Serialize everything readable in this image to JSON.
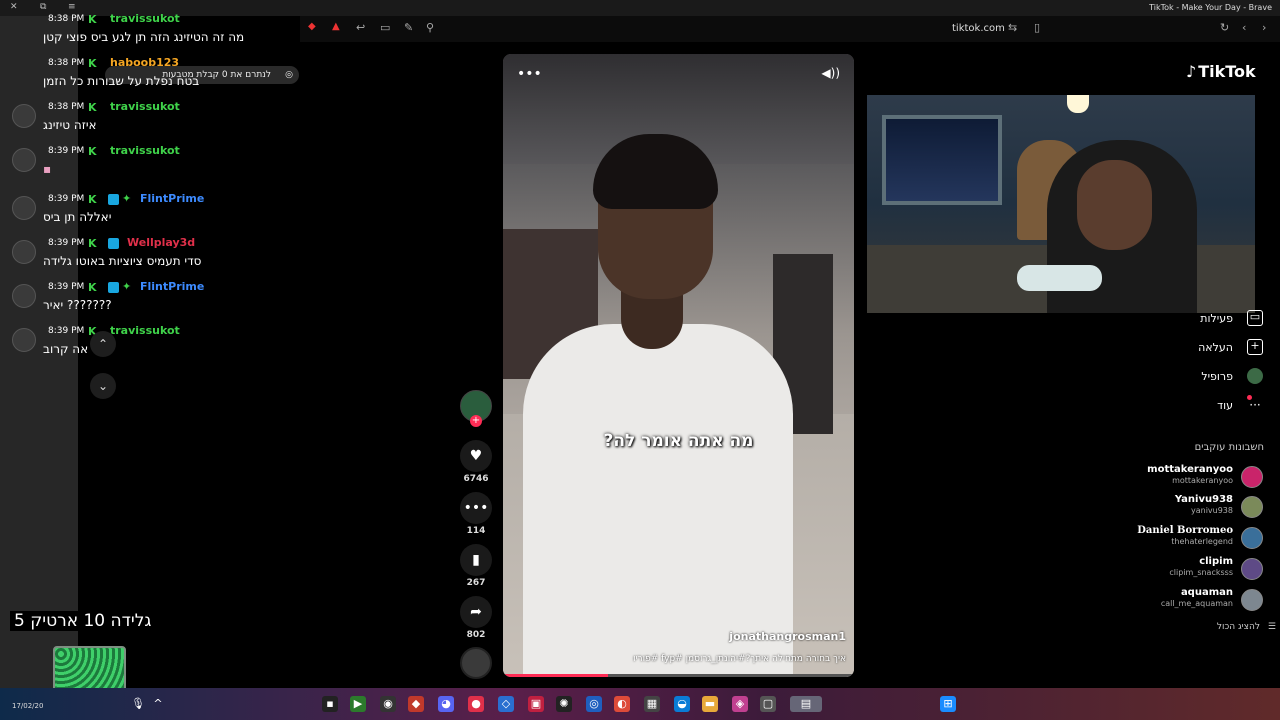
{
  "browser": {
    "window_title": "TikTok - Make Your Day - Brave",
    "url": "tiktok.com"
  },
  "chat": {
    "pinned_top": "מה זה הטיזינג הזה תן לגע ביס פוצי קטן",
    "chip_label": "קבלת מטבעות",
    "chip_sub": "לנתרם את 0",
    "messages": [
      {
        "time": "8:38 PM",
        "user": "travissukot",
        "color": "green",
        "text": ""
      },
      {
        "time": "8:38 PM",
        "user": "haboob123",
        "color": "orange",
        "text": "בטח נפלת על שבורות כל הזמן"
      },
      {
        "time": "8:38 PM",
        "user": "travissukot",
        "color": "green",
        "text": "איזה טיזינג"
      },
      {
        "time": "8:39 PM",
        "user": "travissukot",
        "color": "green",
        "text": ""
      },
      {
        "time": "8:39 PM",
        "user": "FlintPrime",
        "color": "blue",
        "text": "יאללה תן ביס"
      },
      {
        "time": "8:39 PM",
        "user": "Wellplay3d",
        "color": "red",
        "text": "סדי תעמיס ציוציות באוטו גלידה"
      },
      {
        "time": "8:39 PM",
        "user": "FlintPrime",
        "color": "blue",
        "text": "??????? יאיר"
      },
      {
        "time": "8:39 PM",
        "user": "travissukot",
        "color": "green",
        "text": "אה קרוב"
      }
    ]
  },
  "video": {
    "caption": "מה אתה אומר לה?",
    "author": "jonathangrosman1",
    "description": "איך בחורה מתחילה איתך?#יהונתן_גרוסמן #fyp #פוריו",
    "progress": 0.3
  },
  "actions": {
    "likes": "6746",
    "comments": "114",
    "saves": "267",
    "shares": "802"
  },
  "sidebar": {
    "logo": "TikTok",
    "nav": [
      {
        "label": "פעילות",
        "icon": "activity-icon"
      },
      {
        "label": "העלאה",
        "icon": "upload-icon"
      },
      {
        "label": "פרופיל",
        "icon": "profile-icon"
      },
      {
        "label": "עוד",
        "icon": "more-icon"
      }
    ],
    "following_title": "חשבונות עוקבים",
    "following": [
      {
        "name": "mottakeranyoo",
        "handle": "mottakeranyoo"
      },
      {
        "name": "Yanivu938",
        "handle": "yanivu938"
      },
      {
        "name": "Daniel Borromeo",
        "handle": "thehaterlegend"
      },
      {
        "name": "clipim",
        "handle": "clipim_snacksss"
      },
      {
        "name": "aquaman",
        "handle": "call_me_aquaman"
      }
    ],
    "show_all": "להציג הכול"
  },
  "overlay": {
    "text": "גלידה 10 ארטיק 5"
  },
  "taskbar": {
    "date": "17/02/20"
  }
}
